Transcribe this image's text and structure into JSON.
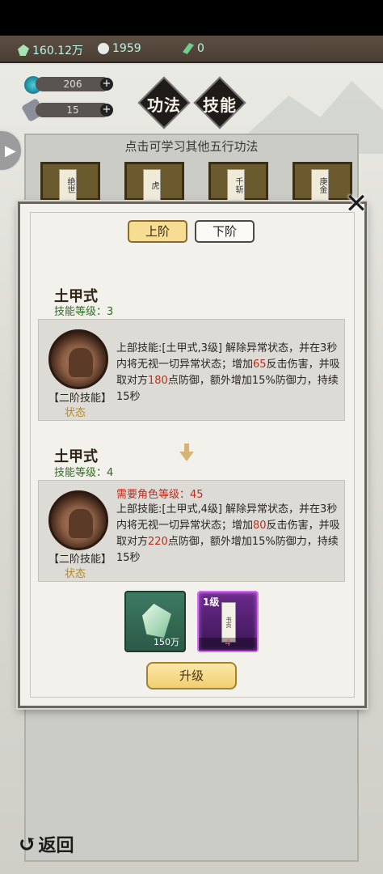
{
  "resources": [
    {
      "icon": "crystal-icon",
      "value": "160.12万"
    },
    {
      "icon": "stone-icon",
      "value": "1959"
    },
    {
      "icon": "leaf-icon",
      "value": "0"
    }
  ],
  "stats": [
    {
      "value": "206"
    },
    {
      "value": "15"
    }
  ],
  "header_tabs": [
    "功法",
    "技能"
  ],
  "panel_title": "点击可学习其他五行功法",
  "books": [
    "绝世",
    "虎",
    "千斩",
    "庚金"
  ],
  "modal": {
    "tabs": {
      "upper": "上阶",
      "lower": "下阶"
    },
    "current": {
      "name": "土甲式",
      "level_label": "技能等级：3",
      "desc_parts": [
        "上部技能:[土甲式,3级] 解除异常状态，并在3秒内将无视一切异常状态；增加",
        "65",
        "反击伤害，并吸取对方",
        "180",
        "点防御，"
      ],
      "tier_label": "【二阶技能】",
      "tier_desc": "额外增加15%防御力，持续15秒",
      "status": "状态"
    },
    "next": {
      "name": "土甲式",
      "level_label": "技能等级：4",
      "requirement": "需要角色等级：45",
      "desc_parts": [
        "上部技能:[土甲式,4级] 解除异常状态，并在3秒内将无视一切异常状态；增加",
        "80",
        "反击伤害，并吸取对方",
        "220",
        "点防御，"
      ],
      "tier_label": "【二阶技能】",
      "tier_desc": "额外增加15%防御力，持续15秒",
      "status": "状态"
    },
    "cost_items": [
      {
        "icon": "crystal-item-icon",
        "count": "150万"
      },
      {
        "icon": "skill-book-icon",
        "level": "1级",
        "page_text": "书页",
        "count": "4"
      }
    ],
    "upgrade_label": "升级"
  },
  "back_label": "返回",
  "colors": {
    "highlight_red": "#c22a1a",
    "level_green": "#2f6b24",
    "status_gold": "#b48a20"
  }
}
